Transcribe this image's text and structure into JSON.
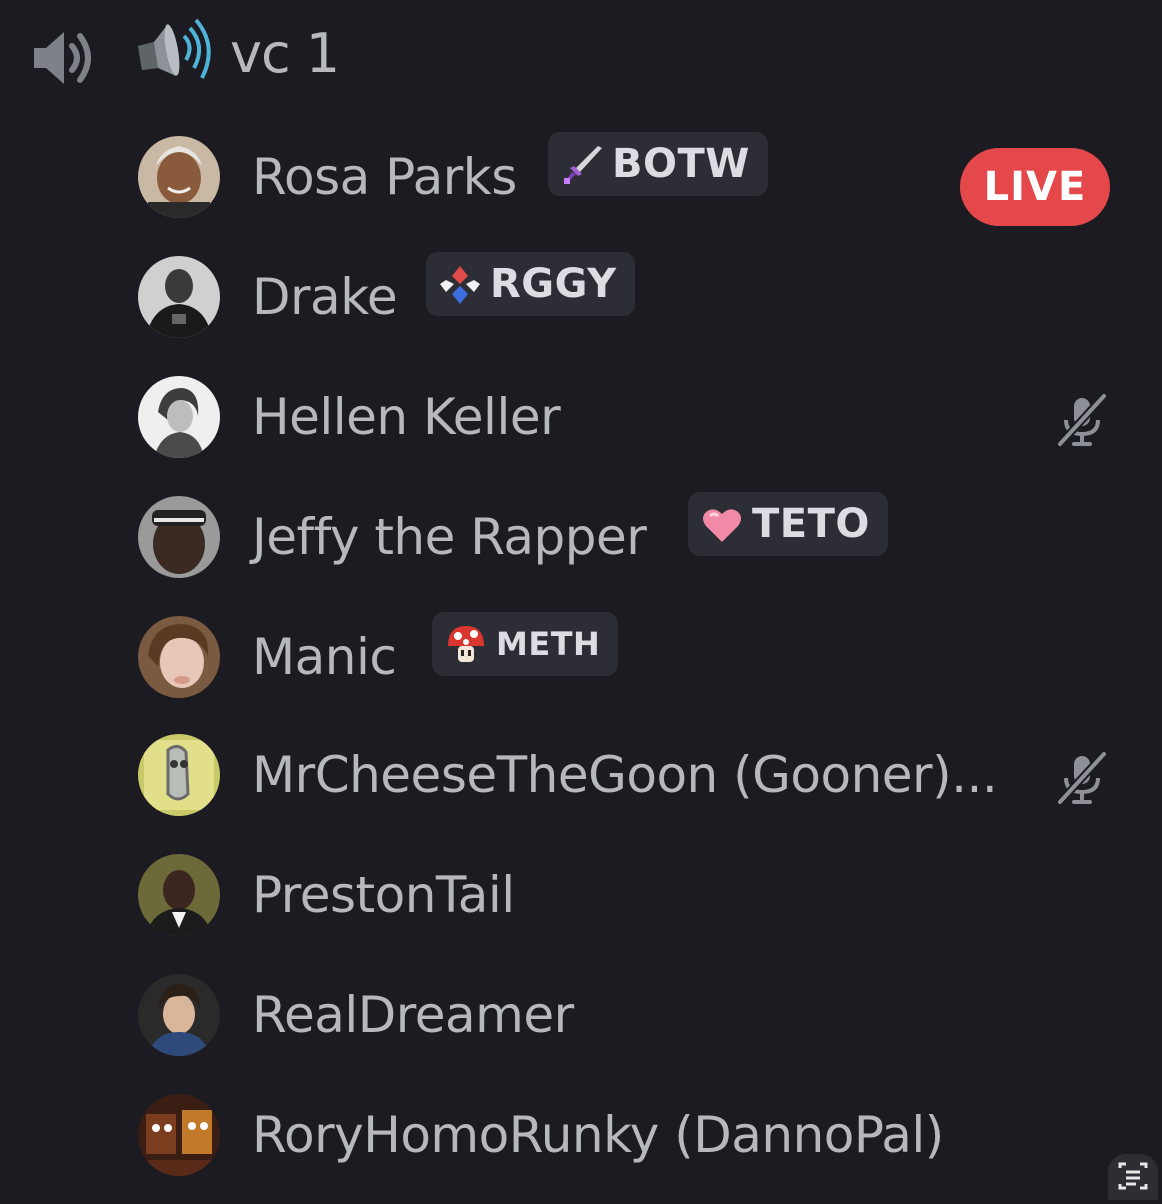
{
  "channel": {
    "name": "vc 1",
    "speaker_icon": "speaker-icon",
    "emoji_icon": "loudspeaker-emoji-icon"
  },
  "members": [
    {
      "name": "Rosa Parks",
      "tag": {
        "label": "BOTW",
        "icon": "sword-icon"
      },
      "live": "LIVE",
      "muted": false
    },
    {
      "name": "Drake",
      "tag": {
        "label": "RGGY",
        "icon": "gem-diamond-icon"
      },
      "muted": false
    },
    {
      "name": "Hellen Keller",
      "muted": true
    },
    {
      "name": "Jeffy the Rapper",
      "tag": {
        "label": "TETO",
        "icon": "heart-icon"
      },
      "muted": false
    },
    {
      "name": "Manic",
      "tag": {
        "label": "METH",
        "icon": "mushroom-icon"
      },
      "muted": false
    },
    {
      "name": "MrCheeseTheGoon (Gooner)...",
      "muted": true
    },
    {
      "name": "PrestonTail",
      "muted": false
    },
    {
      "name": "RealDreamer",
      "muted": false
    },
    {
      "name": "RoryHomoRunky (DannoPal)",
      "muted": false
    }
  ],
  "colors": {
    "background": "#1b1b21",
    "text": "#b6b8be",
    "tag_bg": "#2c2d35",
    "live": "#e5484a"
  }
}
